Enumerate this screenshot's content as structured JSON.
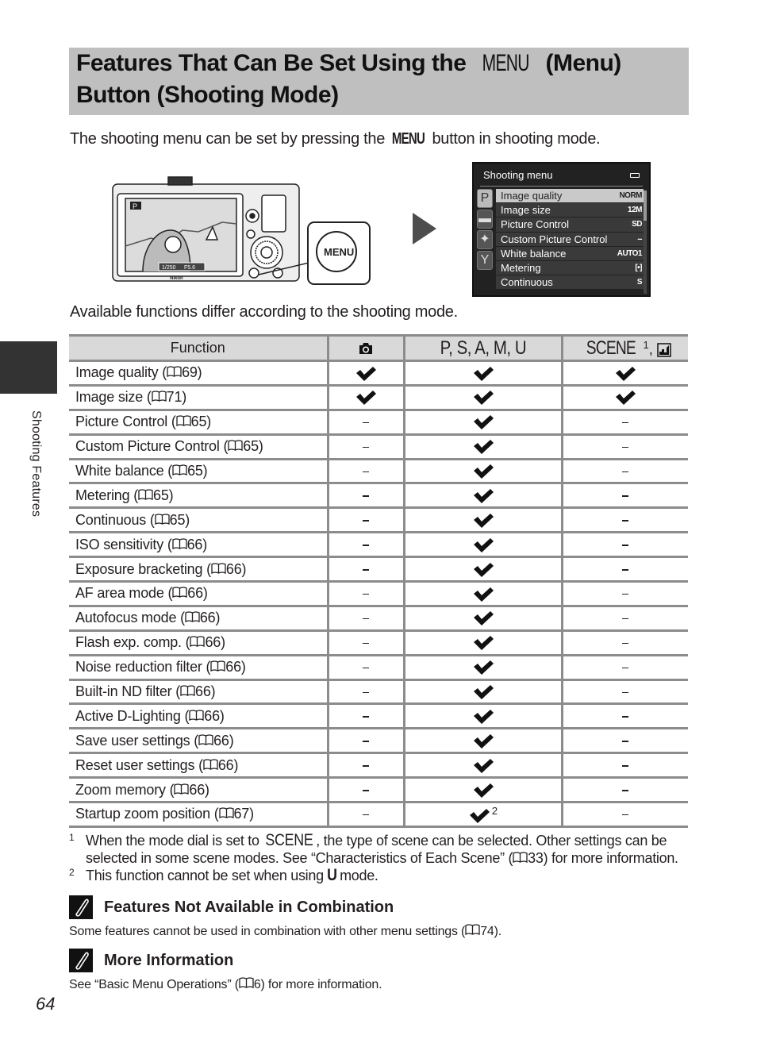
{
  "title": {
    "line1_prefix": "Features That Can Be Set Using the ",
    "menu_glyph": "MENU",
    "line1_suffix": " (Menu)",
    "line2": "Button (Shooting Mode)"
  },
  "intro": {
    "prefix": "The shooting menu can be set by pressing the ",
    "menu_word": "MENU",
    "suffix": " button in shooting mode."
  },
  "illustration": {
    "menu_button_label": "MENU",
    "screen_mode": "P",
    "shutter": "1/250",
    "aperture": "F5.6",
    "brand": "Nikon"
  },
  "shooting_menu": {
    "title": "Shooting menu",
    "tabs": [
      "P",
      "movie",
      "gps",
      "setup"
    ],
    "items": [
      {
        "label": "Image quality",
        "value": "NORM"
      },
      {
        "label": "Image size",
        "value": "12M"
      },
      {
        "label": "Picture Control",
        "value": "SD"
      },
      {
        "label": "Custom Picture Control",
        "value": "--"
      },
      {
        "label": "White balance",
        "value": "AUTO1"
      },
      {
        "label": "Metering",
        "value": "[•]"
      },
      {
        "label": "Continuous",
        "value": "S"
      }
    ]
  },
  "availability_note": "Available functions differ according to the shooting mode.",
  "table": {
    "headers": {
      "function": "Function",
      "auto": "auto-mode-icon",
      "psamu": "P, S, A, M, U",
      "scene": "SCENE",
      "scene_sup": "1",
      "scene_suffix": ", "
    },
    "rows": [
      {
        "name": "Image quality (",
        "page": "69)",
        "auto": "check",
        "psamu": "check",
        "scene": "check"
      },
      {
        "name": "Image size (",
        "page": "71)",
        "auto": "check",
        "psamu": "check",
        "scene": "check"
      },
      {
        "name": "Picture Control (",
        "page": "65)",
        "auto": "–",
        "psamu": "check",
        "scene": "–"
      },
      {
        "name": "Custom Picture Control (",
        "page": "65)",
        "auto": "–",
        "psamu": "check",
        "scene": "–"
      },
      {
        "name": "White balance (",
        "page": "65)",
        "auto": "–",
        "psamu": "check",
        "scene": "–"
      },
      {
        "name": "Metering (",
        "page": "65)",
        "auto": "–",
        "psamu": "check",
        "scene": "–"
      },
      {
        "name": "Continuous (",
        "page": "65)",
        "auto": "–",
        "psamu": "check",
        "scene": "–"
      },
      {
        "name": "ISO sensitivity (",
        "page": "66)",
        "auto": "–",
        "psamu": "check",
        "scene": "–"
      },
      {
        "name": "Exposure bracketing (",
        "page": "66)",
        "auto": "–",
        "psamu": "check",
        "scene": "–"
      },
      {
        "name": "AF area mode (",
        "page": "66)",
        "auto": "–",
        "psamu": "check",
        "scene": "–"
      },
      {
        "name": "Autofocus mode (",
        "page": "66)",
        "auto": "–",
        "psamu": "check",
        "scene": "–"
      },
      {
        "name": "Flash exp. comp. (",
        "page": "66)",
        "auto": "–",
        "psamu": "check",
        "scene": "–"
      },
      {
        "name": "Noise reduction filter (",
        "page": "66)",
        "auto": "–",
        "psamu": "check",
        "scene": "–"
      },
      {
        "name": "Built-in ND filter (",
        "page": "66)",
        "auto": "–",
        "psamu": "check",
        "scene": "–"
      },
      {
        "name": "Active D-Lighting (",
        "page": "66)",
        "auto": "–",
        "psamu": "check",
        "scene": "–"
      },
      {
        "name": "Save user settings (",
        "page": "66)",
        "auto": "–",
        "psamu": "check",
        "scene": "–"
      },
      {
        "name": "Reset user settings (",
        "page": "66)",
        "auto": "–",
        "psamu": "check",
        "scene": "–"
      },
      {
        "name": "Zoom memory (",
        "page": "66)",
        "auto": "–",
        "psamu": "check",
        "scene": "–"
      },
      {
        "name": "Startup zoom position (",
        "page": "67)",
        "auto": "–",
        "psamu": "check",
        "psamu_sup": "2",
        "scene": "–"
      }
    ]
  },
  "footnotes": [
    {
      "num": "1",
      "prefix": "When the mode dial is set to ",
      "scene_word": "SCENE",
      "line1_rest": ", the type of scene can be selected. Other settings can be",
      "line2_prefix": "selected in some scene modes. See “Characteristics of Each Scene” (",
      "line2_page": "33) for more information."
    },
    {
      "num": "2",
      "prefix": "This function cannot be set when using ",
      "mode": "U",
      "suffix": " mode."
    }
  ],
  "notes": [
    {
      "heading": "Features Not Available in Combination",
      "text_prefix": "Some features cannot be used in combination with other menu settings (",
      "text_page": "74)."
    },
    {
      "heading": "More Information",
      "text_prefix": "See “Basic Menu Operations” (",
      "text_page": "6) for more information."
    }
  ],
  "side_label": "Shooting Features",
  "page_number": "64"
}
